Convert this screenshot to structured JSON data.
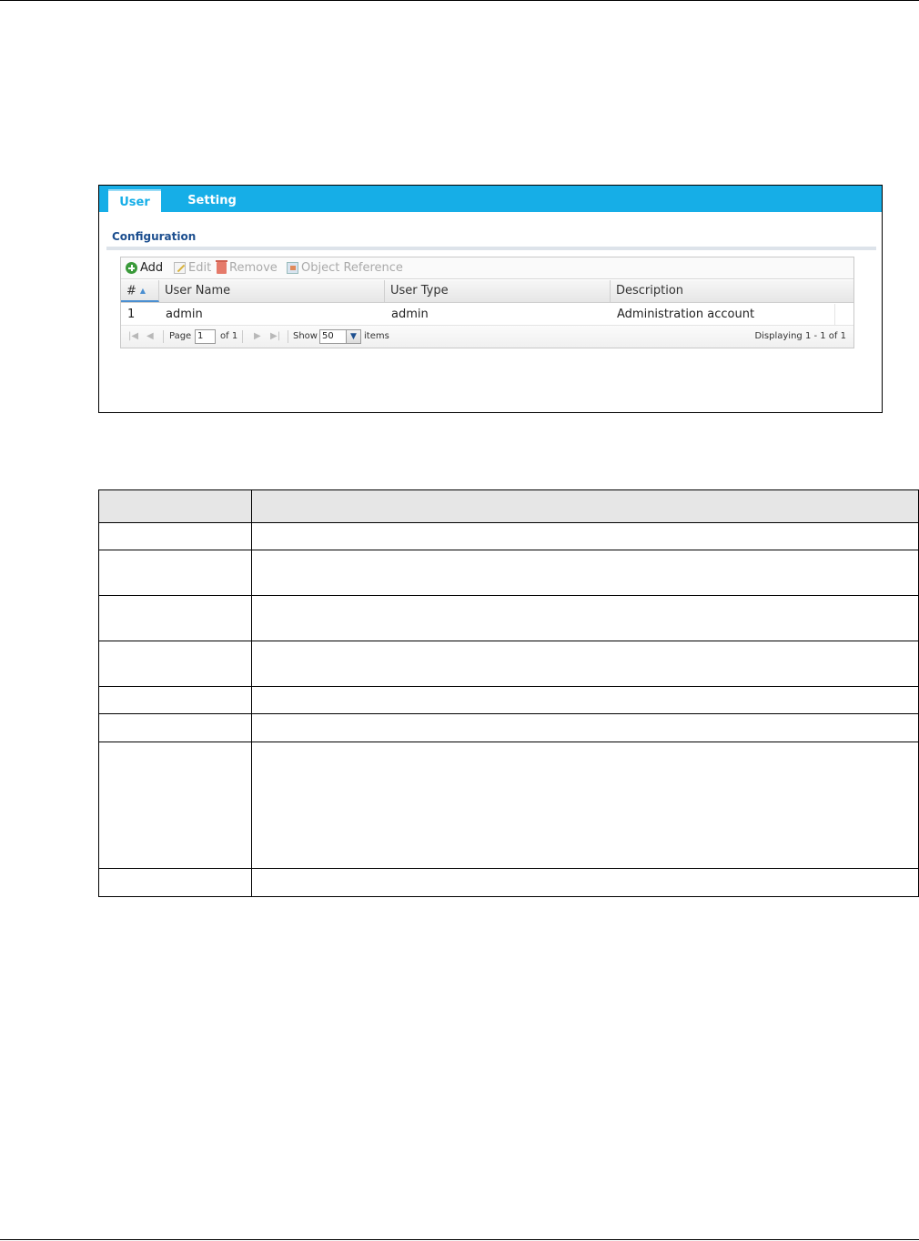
{
  "tabs": [
    {
      "label": "User",
      "active": true
    },
    {
      "label": "Setting",
      "active": false
    }
  ],
  "section_title": "Configuration",
  "toolbar": {
    "add": "Add",
    "edit": "Edit",
    "remove": "Remove",
    "object_reference": "Object Reference"
  },
  "columns": [
    "#",
    "User Name",
    "User Type",
    "Description"
  ],
  "rows": [
    {
      "num": "1",
      "user_name": "admin",
      "user_type": "admin",
      "description": "Administration account"
    }
  ],
  "pager": {
    "page_label": "Page",
    "page_value": "1",
    "of_label": "of 1",
    "show_label": "Show",
    "show_value": "50",
    "items_label": "items",
    "displaying": "Displaying 1 - 1 of 1"
  },
  "colors": {
    "tab_bar": "#16aee7",
    "section_title": "#1d4f8f"
  }
}
